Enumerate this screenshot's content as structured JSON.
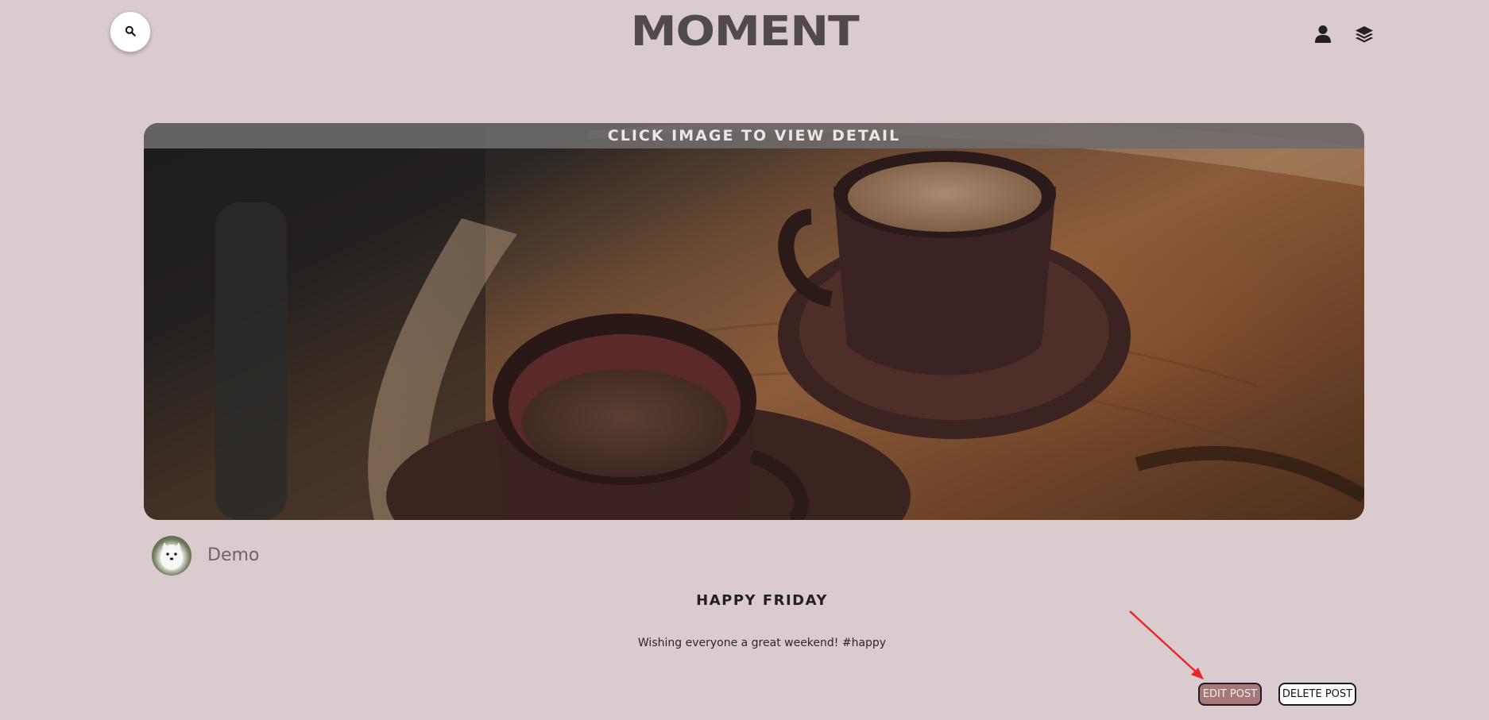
{
  "header": {
    "logo": "MOMENT",
    "search_icon": "search-icon",
    "user_icon": "user-icon",
    "layers_icon": "layers-icon"
  },
  "post": {
    "image_banner": "CLICK IMAGE TO VIEW DETAIL",
    "image_subject": "two coffee cups on saucers on a wooden table",
    "author": {
      "name": "Demo",
      "avatar": "white dog avatar"
    },
    "title": "HAPPY FRIDAY",
    "body": "Wishing everyone a great weekend! #happy"
  },
  "actions": {
    "edit_label": "EDIT POST",
    "delete_label": "DELETE POST"
  },
  "colors": {
    "background": "#dacbce",
    "logo": "#4f4a4b",
    "edit_button": "#a7787a",
    "annotation_arrow": "#e8272a"
  }
}
